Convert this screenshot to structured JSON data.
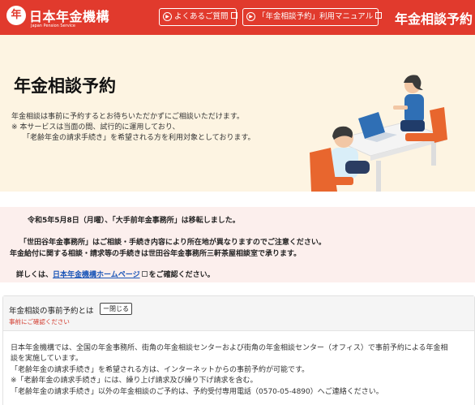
{
  "header": {
    "logo_mark": "年",
    "logo_title": "日本年金機構",
    "logo_sub": "Japan Pension Service",
    "faq_label": "よくあるご質問",
    "manual_label": "「年金相談予約」利用マニュアル",
    "page_title": "年金相談予約",
    "colors": {
      "brand": "#e13a2d"
    }
  },
  "hero": {
    "title": "年金相談予約",
    "lines": [
      "年金相談は事前に予約するとお待ちいただかずにご相談いただけます。",
      "※ 本サービスは当面の間、試行的に運用しており、",
      "「老齢年金の請求手続き」を希望される方を利用対象としております。"
    ]
  },
  "notice": {
    "line1": "令和5年5月8日（月曜）、「大手前年金事務所」は移転しました。",
    "line2": "「世田谷年金事務所」はご相談・手続き内容により所在地が異なりますのでご注意ください。",
    "line3": "年金給付に関する相談・請求等の手続きは世田谷年金事務所三軒茶屋相談室で承ります。",
    "line4_prefix": "詳しくは、",
    "line4_link": "日本年金機構ホームページ",
    "line4_suffix": "をご確認ください。"
  },
  "reservation": {
    "title": "年金相談の事前予約とは",
    "close_label": "ー閉じる",
    "warning": "事前にご確認ください",
    "body": [
      "日本年金機構では、全国の年金事務所、街角の年金相談センターおよび街角の年金相談センター（オフィス）で事前予約による年金相",
      "談を実施しています。",
      "「老齢年金の請求手続き」を希望される方は、インターネットからの事前予約が可能です。",
      "※「老齢年金の請求手続き」には、繰り上げ請求及び繰り下げ請求を含む。",
      "「老齢年金の請求手続き」以外の年金相談のご予約は、予約受付専用電話（0570-05-4890）へご連絡ください。"
    ]
  }
}
